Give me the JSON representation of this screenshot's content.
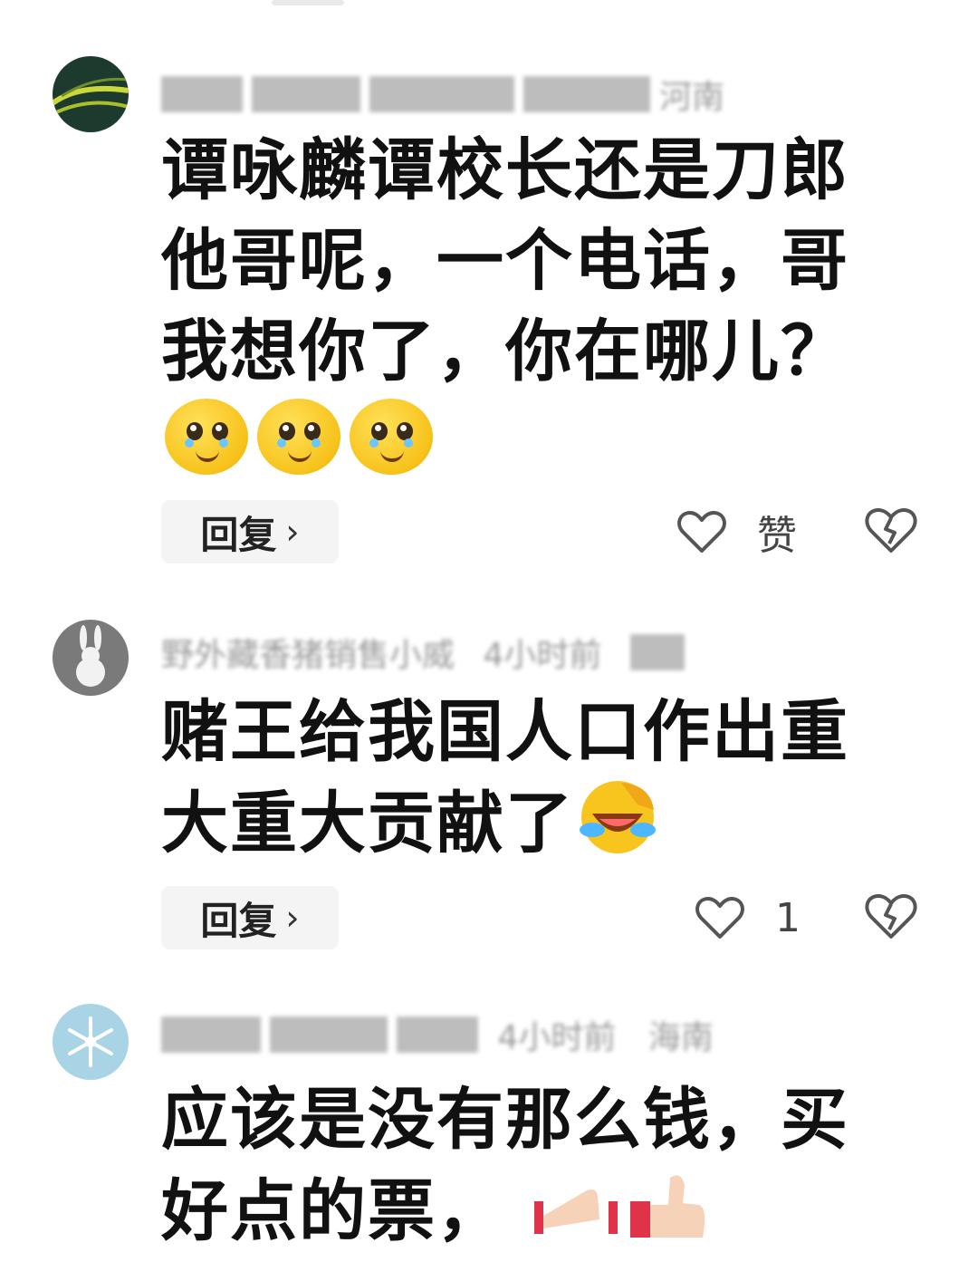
{
  "comments": [
    {
      "meta_location": "河南",
      "text": "谭咏麟谭校长还是刀郎他哥呢，一个电话，哥我想你了，你在哪儿？",
      "emoji_count": 3,
      "emoji_name": "pleading-face",
      "reply_label": "回复",
      "reply_chevron": "›",
      "like_label": "赞",
      "like_icon": "heart-icon",
      "dislike_icon": "broken-heart-icon"
    },
    {
      "meta_name": "野外藏香猪销售小威",
      "meta_time": "4小时前",
      "text": "赌王给我国人口作出重大重大贡献了",
      "trailing_emoji": "laughing-crying-face",
      "reply_label": "回复",
      "reply_chevron": "›",
      "like_label": "1",
      "like_icon": "heart-icon",
      "dislike_icon": "broken-heart-icon"
    },
    {
      "meta_time": "4小时前",
      "meta_location": "海南",
      "text": "应该是没有那么钱，买好点的票，",
      "trailing_emoji": "clap-and-thumbs-up"
    }
  ],
  "colors": {
    "text": "#111111",
    "meta": "#9a9a9a",
    "reply_bg": "#f4f4f4",
    "icon": "#555555"
  }
}
